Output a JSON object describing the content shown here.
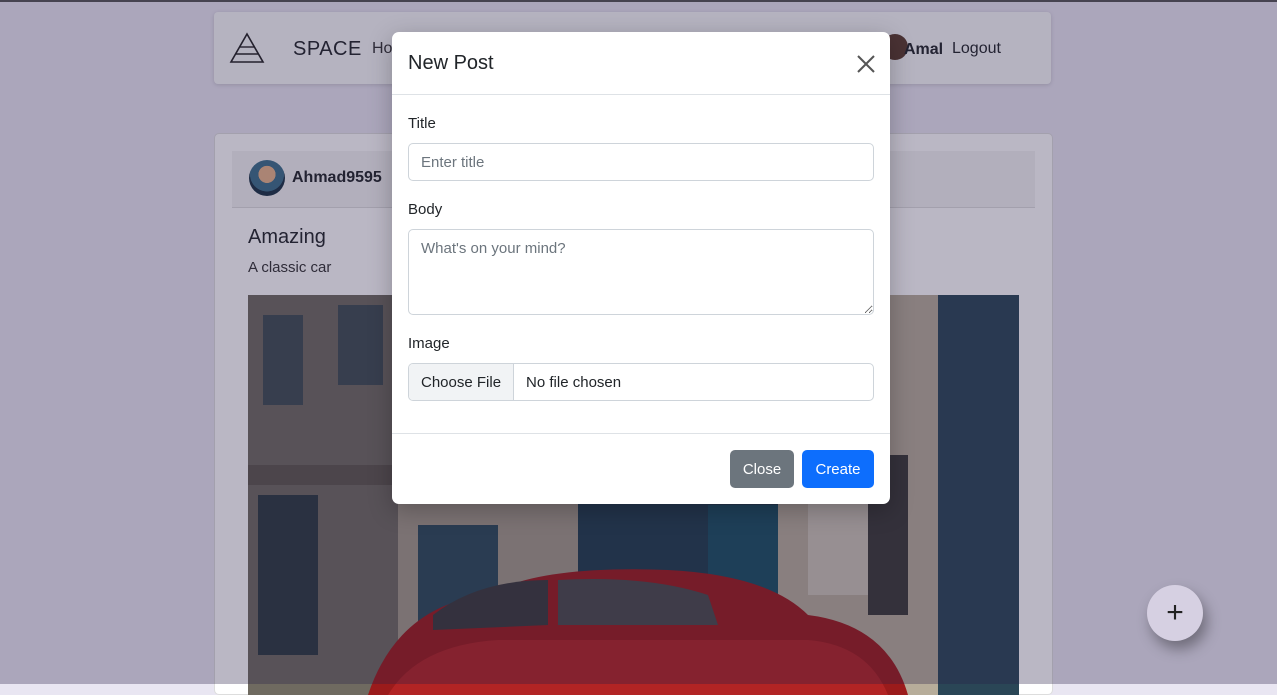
{
  "navbar": {
    "brand": "SPACE",
    "home_label": "Ho",
    "username": "Amal",
    "logout_label": "Logout"
  },
  "post": {
    "username": "Ahmad9595",
    "title": "Amazing",
    "body": "A classic car"
  },
  "modal": {
    "title": "New Post",
    "title_label": "Title",
    "title_placeholder": "Enter title",
    "body_label": "Body",
    "body_placeholder": "What's on your mind?",
    "image_label": "Image",
    "file_button": "Choose File",
    "file_status": "No file chosen",
    "close_label": "Close",
    "create_label": "Create"
  },
  "fab": {
    "icon": "+"
  },
  "colors": {
    "primary": "#0d6efd",
    "secondary": "#6c757d",
    "car": "#9b1b1b",
    "wall": "#1f3d4c"
  }
}
